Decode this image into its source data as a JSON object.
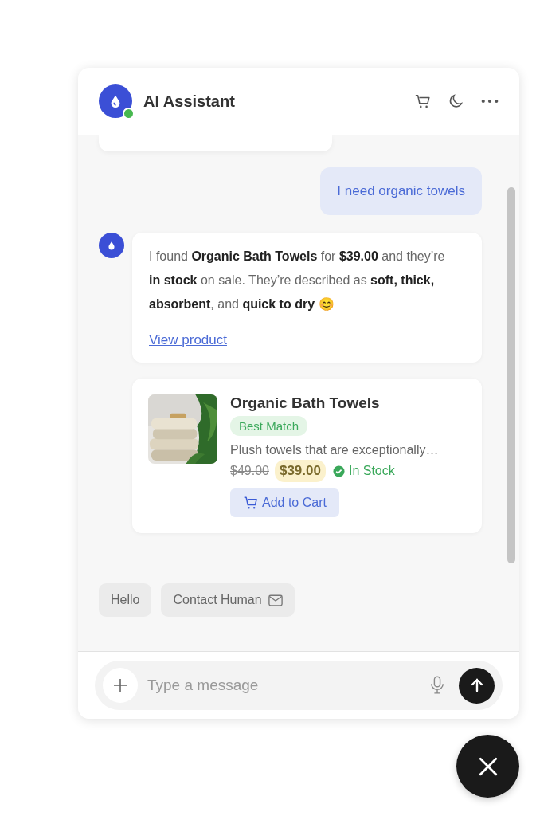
{
  "header": {
    "title": "AI Assistant",
    "online": true
  },
  "messages": [
    {
      "kind": "user",
      "text": "I need organic towels"
    },
    {
      "kind": "bot",
      "text": "I found **Organic Bath Towels** for **$39.00** and they’re **in stock** on sale. They’re described as **soft, thick, absorbent**, and **quick to dry** 😊",
      "link": "View product"
    }
  ],
  "product": {
    "kind": "picture",
    "name": "Organic Bath Towels",
    "badge": "Best Match",
    "description": "Plush towels that are exceptionally…",
    "old_price": "$49.00",
    "price": "$39.00",
    "stock": "In Stock",
    "in_stock": true,
    "button": "Add to Cart"
  },
  "quick_replies": [
    {
      "label": "Hello",
      "kind": "plain"
    },
    {
      "label": "Contact Human",
      "kind": "mail"
    }
  ],
  "input": {
    "placeholder": "Type a message"
  }
}
